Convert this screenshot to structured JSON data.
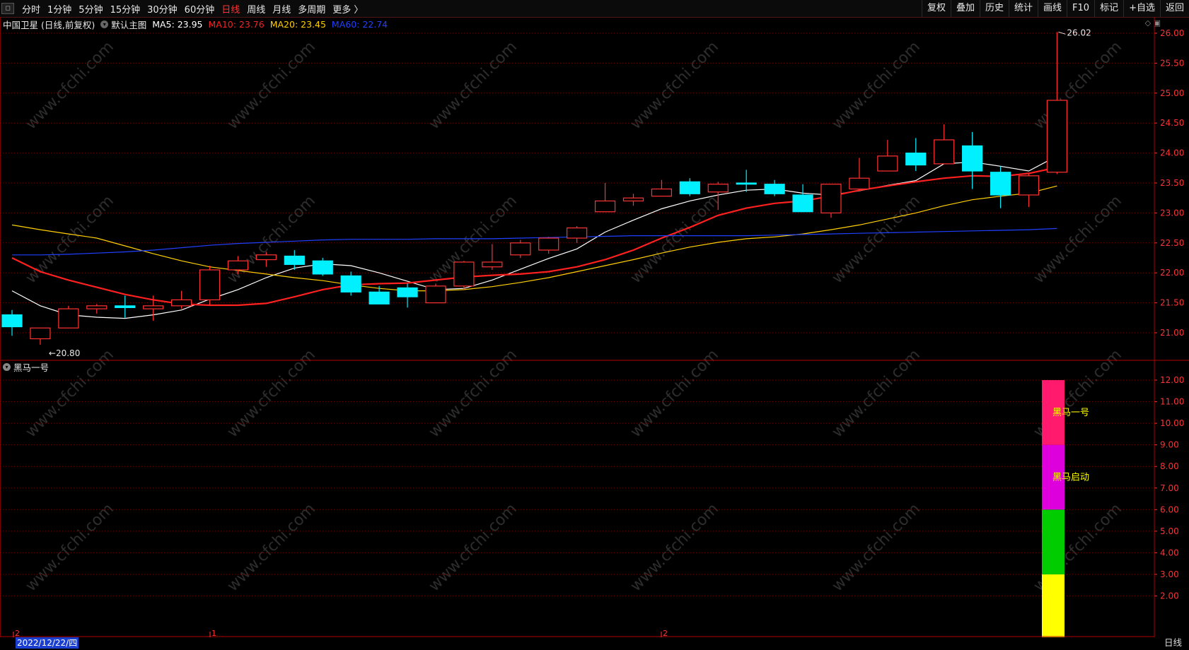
{
  "toolbar": {
    "corner_icon": "window-restore-icon",
    "periods": [
      {
        "label": "分时",
        "active": false
      },
      {
        "label": "1分钟",
        "active": false
      },
      {
        "label": "5分钟",
        "active": false
      },
      {
        "label": "15分钟",
        "active": false
      },
      {
        "label": "30分钟",
        "active": false
      },
      {
        "label": "60分钟",
        "active": false
      },
      {
        "label": "日线",
        "active": true
      },
      {
        "label": "周线",
        "active": false
      },
      {
        "label": "月线",
        "active": false
      },
      {
        "label": "多周期",
        "active": false
      },
      {
        "label": "更多 〉",
        "active": false
      }
    ],
    "right_buttons": [
      "复权",
      "叠加",
      "历史",
      "统计",
      "画线",
      "F10",
      "标记",
      "+自选",
      "返回"
    ]
  },
  "main_info": {
    "stock": "中国卫星 (日线,前复权)",
    "template": "默认主图",
    "ma5": "MA5: 23.95",
    "ma10": "MA10: 23.76",
    "ma20": "MA20: 23.45",
    "ma60": "MA60: 22.74",
    "colors": {
      "ma5": "#ffffff",
      "ma10": "#ff2020",
      "ma20": "#ffd000",
      "ma60": "#2040ff",
      "up": "#ff3232",
      "down": "#00f0ff",
      "grid": "#7a0000"
    }
  },
  "sub_info": {
    "name": "黑马一号"
  },
  "price_labels": {
    "high": "26.02",
    "low": "←20.80"
  },
  "watermark": "www.cfchi.com",
  "chart_data": [
    {
      "type": "candlestick",
      "title": "中国卫星 (日线,前复权)",
      "ylim": [
        20.5,
        26.2
      ],
      "y_ticks": [
        "26.00",
        "25.50",
        "25.00",
        "24.50",
        "24.00",
        "23.50",
        "23.00",
        "22.50",
        "22.00",
        "21.50",
        "21.00"
      ],
      "candles": [
        {
          "o": 21.3,
          "h": 21.38,
          "c": 21.1,
          "l": 20.95
        },
        {
          "o": 20.9,
          "h": 21.08,
          "c": 21.08,
          "l": 20.8
        },
        {
          "o": 21.08,
          "h": 21.45,
          "c": 21.4,
          "l": 21.08
        },
        {
          "o": 21.4,
          "h": 21.48,
          "c": 21.45,
          "l": 21.32
        },
        {
          "o": 21.45,
          "h": 21.62,
          "c": 21.42,
          "l": 21.25
        },
        {
          "o": 21.4,
          "h": 21.62,
          "c": 21.45,
          "l": 21.2
        },
        {
          "o": 21.45,
          "h": 21.7,
          "c": 21.55,
          "l": 21.4
        },
        {
          "o": 21.55,
          "h": 22.12,
          "c": 22.05,
          "l": 21.45
        },
        {
          "o": 22.05,
          "h": 22.28,
          "c": 22.2,
          "l": 21.98
        },
        {
          "o": 22.22,
          "h": 22.35,
          "c": 22.3,
          "l": 22.1
        },
        {
          "o": 22.28,
          "h": 22.38,
          "c": 22.14,
          "l": 22.05
        },
        {
          "o": 22.2,
          "h": 22.25,
          "c": 21.98,
          "l": 21.95
        },
        {
          "o": 21.95,
          "h": 22.02,
          "c": 21.68,
          "l": 21.62
        },
        {
          "o": 21.68,
          "h": 21.78,
          "c": 21.48,
          "l": 21.48
        },
        {
          "o": 21.75,
          "h": 21.82,
          "c": 21.6,
          "l": 21.42
        },
        {
          "o": 21.5,
          "h": 21.82,
          "c": 21.78,
          "l": 21.5
        },
        {
          "o": 21.78,
          "h": 22.2,
          "c": 22.18,
          "l": 21.72
        },
        {
          "o": 22.1,
          "h": 22.48,
          "c": 22.18,
          "l": 22.05
        },
        {
          "o": 22.3,
          "h": 22.55,
          "c": 22.5,
          "l": 22.25
        },
        {
          "o": 22.38,
          "h": 22.6,
          "c": 22.58,
          "l": 22.32
        },
        {
          "o": 22.58,
          "h": 22.78,
          "c": 22.75,
          "l": 22.5
        },
        {
          "o": 23.02,
          "h": 23.5,
          "c": 23.2,
          "l": 23.02
        },
        {
          "o": 23.2,
          "h": 23.32,
          "c": 23.25,
          "l": 23.12
        },
        {
          "o": 23.28,
          "h": 23.55,
          "c": 23.4,
          "l": 23.28
        },
        {
          "o": 23.52,
          "h": 23.58,
          "c": 23.32,
          "l": 23.28
        },
        {
          "o": 23.35,
          "h": 23.52,
          "c": 23.48,
          "l": 23.05
        },
        {
          "o": 23.5,
          "h": 23.72,
          "c": 23.48,
          "l": 23.35
        },
        {
          "o": 23.48,
          "h": 23.55,
          "c": 23.32,
          "l": 23.28
        },
        {
          "o": 23.3,
          "h": 23.48,
          "c": 23.02,
          "l": 23.02
        },
        {
          "o": 23.0,
          "h": 23.48,
          "c": 23.48,
          "l": 22.92
        },
        {
          "o": 23.4,
          "h": 23.92,
          "c": 23.58,
          "l": 23.4
        },
        {
          "o": 23.7,
          "h": 24.22,
          "c": 23.95,
          "l": 23.7
        },
        {
          "o": 24.0,
          "h": 24.25,
          "c": 23.8,
          "l": 23.7
        },
        {
          "o": 23.82,
          "h": 24.48,
          "c": 24.22,
          "l": 23.82
        },
        {
          "o": 24.12,
          "h": 24.35,
          "c": 23.7,
          "l": 23.4
        },
        {
          "o": 23.68,
          "h": 23.78,
          "c": 23.3,
          "l": 23.08
        },
        {
          "o": 23.3,
          "h": 23.65,
          "c": 23.62,
          "l": 23.1
        },
        {
          "o": 23.68,
          "h": 26.02,
          "c": 24.88,
          "l": 23.65
        }
      ],
      "series": [
        {
          "name": "MA5",
          "values": [
            21.7,
            21.45,
            21.3,
            21.26,
            21.24,
            21.3,
            21.38,
            21.56,
            21.72,
            21.92,
            22.08,
            22.15,
            22.12,
            22.0,
            21.86,
            21.72,
            21.74,
            21.88,
            22.06,
            22.24,
            22.4,
            22.68,
            22.88,
            23.07,
            23.2,
            23.3,
            23.38,
            23.4,
            23.33,
            23.3,
            23.37,
            23.46,
            23.54,
            23.82,
            23.85,
            23.78,
            23.7,
            23.95
          ]
        },
        {
          "name": "MA10",
          "values": [
            22.25,
            22.02,
            21.88,
            21.76,
            21.64,
            21.55,
            21.48,
            21.46,
            21.46,
            21.49,
            21.6,
            21.72,
            21.8,
            21.82,
            21.83,
            21.88,
            21.93,
            21.96,
            21.98,
            22.02,
            22.1,
            22.22,
            22.38,
            22.58,
            22.76,
            22.96,
            23.08,
            23.16,
            23.2,
            23.28,
            23.38,
            23.45,
            23.52,
            23.58,
            23.62,
            23.61,
            23.66,
            23.76
          ]
        },
        {
          "name": "MA20",
          "values": [
            22.8,
            22.72,
            22.65,
            22.58,
            22.45,
            22.32,
            22.2,
            22.1,
            22.04,
            21.98,
            21.92,
            21.87,
            21.8,
            21.74,
            21.7,
            21.7,
            21.72,
            21.77,
            21.84,
            21.92,
            22.02,
            22.12,
            22.22,
            22.33,
            22.43,
            22.51,
            22.57,
            22.6,
            22.65,
            22.72,
            22.8,
            22.9,
            23.0,
            23.12,
            23.22,
            23.28,
            23.33,
            23.45
          ]
        },
        {
          "name": "MA60",
          "values": [
            22.3,
            22.3,
            22.31,
            22.33,
            22.35,
            22.38,
            22.42,
            22.46,
            22.49,
            22.51,
            22.53,
            22.55,
            22.56,
            22.56,
            22.56,
            22.57,
            22.57,
            22.57,
            22.58,
            22.59,
            22.6,
            22.61,
            22.62,
            22.62,
            22.62,
            22.62,
            22.62,
            22.63,
            22.64,
            22.65,
            22.66,
            22.67,
            22.68,
            22.69,
            22.7,
            22.71,
            22.72,
            22.74
          ]
        }
      ]
    },
    {
      "type": "bar",
      "title": "黑马一号",
      "ylim": [
        1.0,
        12.5
      ],
      "y_ticks": [
        "12.00",
        "11.00",
        "10.00",
        "9.00",
        "8.00",
        "7.00",
        "6.00",
        "5.00",
        "4.00",
        "3.00",
        "2.00"
      ],
      "stacked_segments": [
        {
          "from": 0,
          "to": 3,
          "color": "#ffff00",
          "label": ""
        },
        {
          "from": 3,
          "to": 6,
          "color": "#00cc00",
          "label": ""
        },
        {
          "from": 6,
          "to": 9,
          "color": "#dd00dd",
          "label": "黑马启动"
        },
        {
          "from": 9,
          "to": 12,
          "color": "#ff1a6e",
          "label": "黑马一号"
        }
      ]
    }
  ],
  "bottom_axis": {
    "date": "2022/12/22/四",
    "markers": [
      "2",
      "1",
      "2"
    ],
    "period": "日线"
  }
}
